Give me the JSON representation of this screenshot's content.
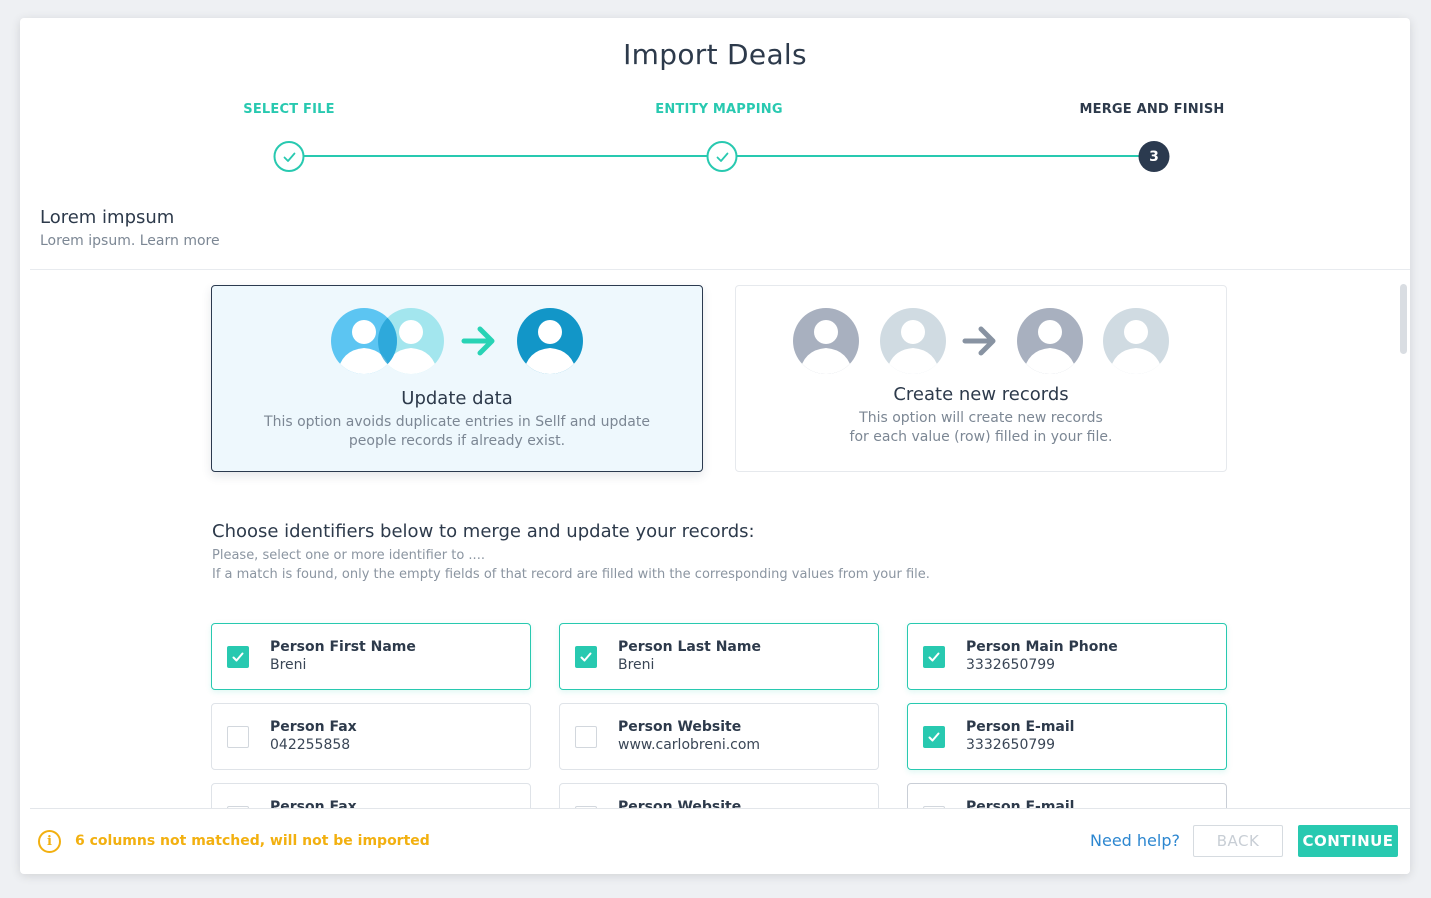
{
  "dialog": {
    "title": "Import Deals"
  },
  "steps": [
    {
      "label": "SELECT FILE",
      "state": "done"
    },
    {
      "label": "ENTITY MAPPING",
      "state": "done"
    },
    {
      "label": "MERGE AND FINISH",
      "state": "active",
      "number": "3"
    }
  ],
  "section": {
    "title": "Lorem impsum",
    "subtitle": "Lorem ipsum. Learn more"
  },
  "options": [
    {
      "title": "Update data",
      "desc_line1": "This option avoids duplicate entries in Sellf and update",
      "desc_line2": "people records if already exist.",
      "selected": true,
      "icons": [
        "user-avatar-icon",
        "user-avatar-icon",
        "arrow-right-icon",
        "user-avatar-icon"
      ]
    },
    {
      "title": "Create new records",
      "desc_line1": "This option will create new records",
      "desc_line2": "for each value (row) filled in your file.",
      "selected": false,
      "icons": [
        "user-avatar-icon",
        "user-avatar-icon",
        "arrow-right-icon",
        "user-avatar-icon",
        "user-avatar-icon"
      ]
    }
  ],
  "identifiers": {
    "title": "Choose identifiers below to merge and update your records:",
    "subtitle1": "Please, select one or more identifier to ....",
    "subtitle2": "If a match is found, only the empty fields of that record are filled with the corresponding values from your file.",
    "fields": [
      {
        "name": "Person First Name",
        "value": "Breni",
        "checked": true
      },
      {
        "name": "Person Last Name",
        "value": "Breni",
        "checked": true
      },
      {
        "name": "Person Main Phone",
        "value": "3332650799",
        "checked": true
      },
      {
        "name": "Person Fax",
        "value": "042255858",
        "checked": false
      },
      {
        "name": "Person Website",
        "value": "www.carlobreni.com",
        "checked": false
      },
      {
        "name": "Person E-mail",
        "value": "3332650799",
        "checked": true
      },
      {
        "name": "Person Fax",
        "value": "",
        "checked": false
      },
      {
        "name": "Person Website",
        "value": "",
        "checked": false
      },
      {
        "name": "Person E-mail",
        "value": "",
        "checked": false
      }
    ]
  },
  "footer": {
    "warning": "6 columns not matched, will not be imported",
    "warning_icon": "info-icon",
    "help": "Need help?",
    "back": "BACK",
    "continue": "CONTINUE"
  },
  "colors": {
    "accent": "#28c9b0",
    "dark": "#2b3a4f",
    "warning": "#f2b010",
    "link": "#2d87d0"
  }
}
